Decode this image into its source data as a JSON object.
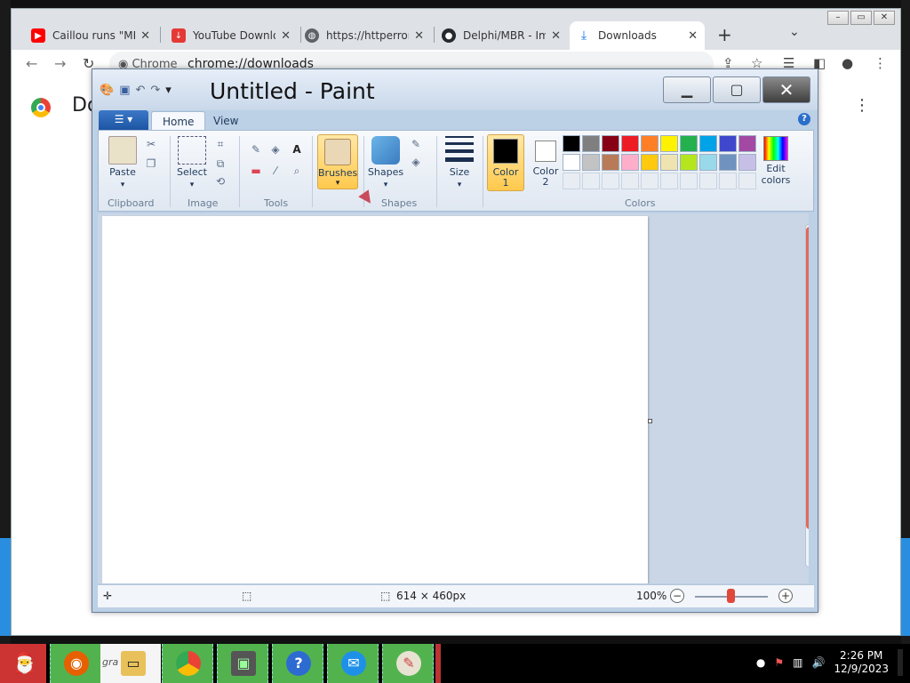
{
  "chrome": {
    "tabs": [
      {
        "title": "Caillou runs \"MEI",
        "favicon": "youtube-icon"
      },
      {
        "title": "YouTube Downlo",
        "favicon": "download-red-icon"
      },
      {
        "title": "https://httperron",
        "favicon": "globe-icon"
      },
      {
        "title": "Delphi/MBR - Im",
        "favicon": "github-icon"
      },
      {
        "title": "Downloads",
        "favicon": "download-icon",
        "active": true
      }
    ],
    "omnibox_label": "Chrome",
    "url": "chrome://downloads",
    "page_title": "Do"
  },
  "paint": {
    "title": "Untitled - Paint",
    "tabs": {
      "home": "Home",
      "view": "View"
    },
    "clipboard": {
      "paste": "Paste",
      "label": "Clipboard"
    },
    "image": {
      "select": "Select",
      "label": "Image"
    },
    "tools": {
      "label": "Tools"
    },
    "brushes": "Brushes",
    "shapes": {
      "button": "Shapes",
      "label": "Shapes"
    },
    "size": "Size",
    "color1": {
      "line1": "Color",
      "line2": "1"
    },
    "color2": {
      "line1": "Color",
      "line2": "2"
    },
    "colors_label": "Colors",
    "edit_colors": {
      "line1": "Edit",
      "line2": "colors"
    },
    "palette": [
      "#000000",
      "#7f7f7f",
      "#880015",
      "#ed1c24",
      "#ff7f27",
      "#fff200",
      "#22b14c",
      "#00a2e8",
      "#3f48cc",
      "#a349a4",
      "#ffffff",
      "#c3c3c3",
      "#b97a57",
      "#ffaec9",
      "#ffc90e",
      "#efe4b0",
      "#b5e61d",
      "#99d9ea",
      "#7092be",
      "#c8bfe7"
    ],
    "status": {
      "dimensions": "614 × 460px",
      "zoom": "100%"
    }
  },
  "taskbar": {
    "folder_text": "gra  d fi",
    "time": "2:26 PM",
    "date": "12/9/2023"
  }
}
